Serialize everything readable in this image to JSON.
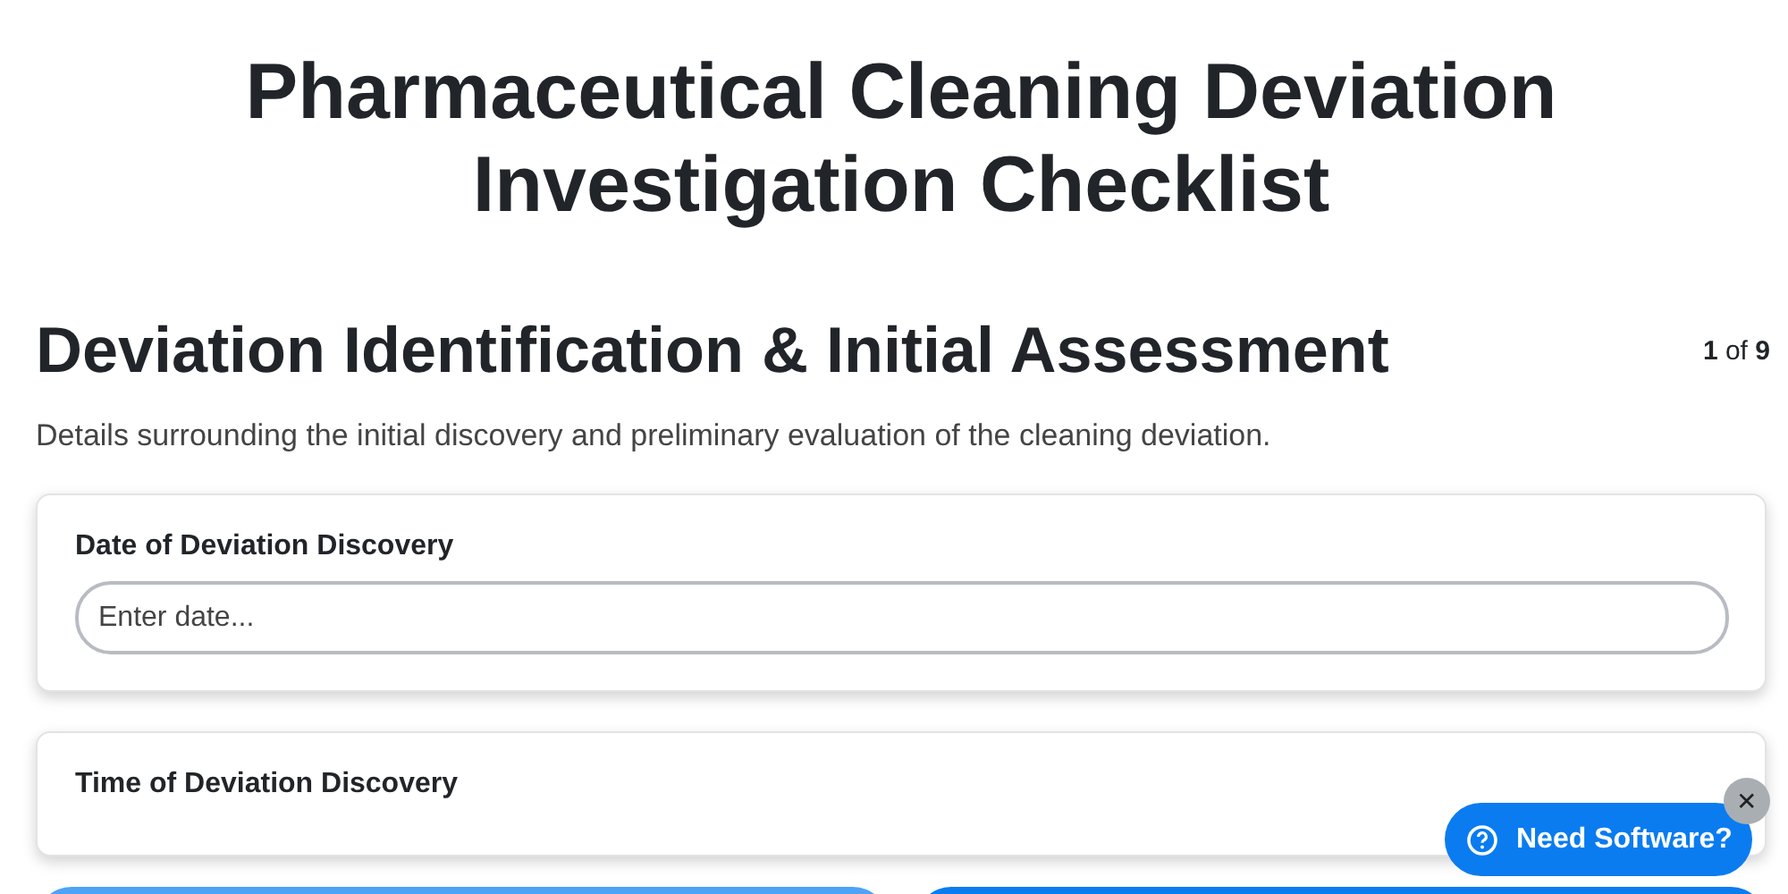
{
  "title": "Pharmaceutical Cleaning Deviation Investigation Checklist",
  "section": {
    "heading": "Deviation Identification & Initial Assessment",
    "progress": "**1** of **9**",
    "description": "Details surrounding the initial discovery and preliminary evaluation of the cleaning deviation."
  },
  "fields": [
    {
      "label": "Date of Deviation Discovery",
      "placeholder": "Enter date..."
    },
    {
      "label": "Time of Deviation Discovery"
    }
  ],
  "help_widget": {
    "label": "Need Software?",
    "close": "✕"
  }
}
